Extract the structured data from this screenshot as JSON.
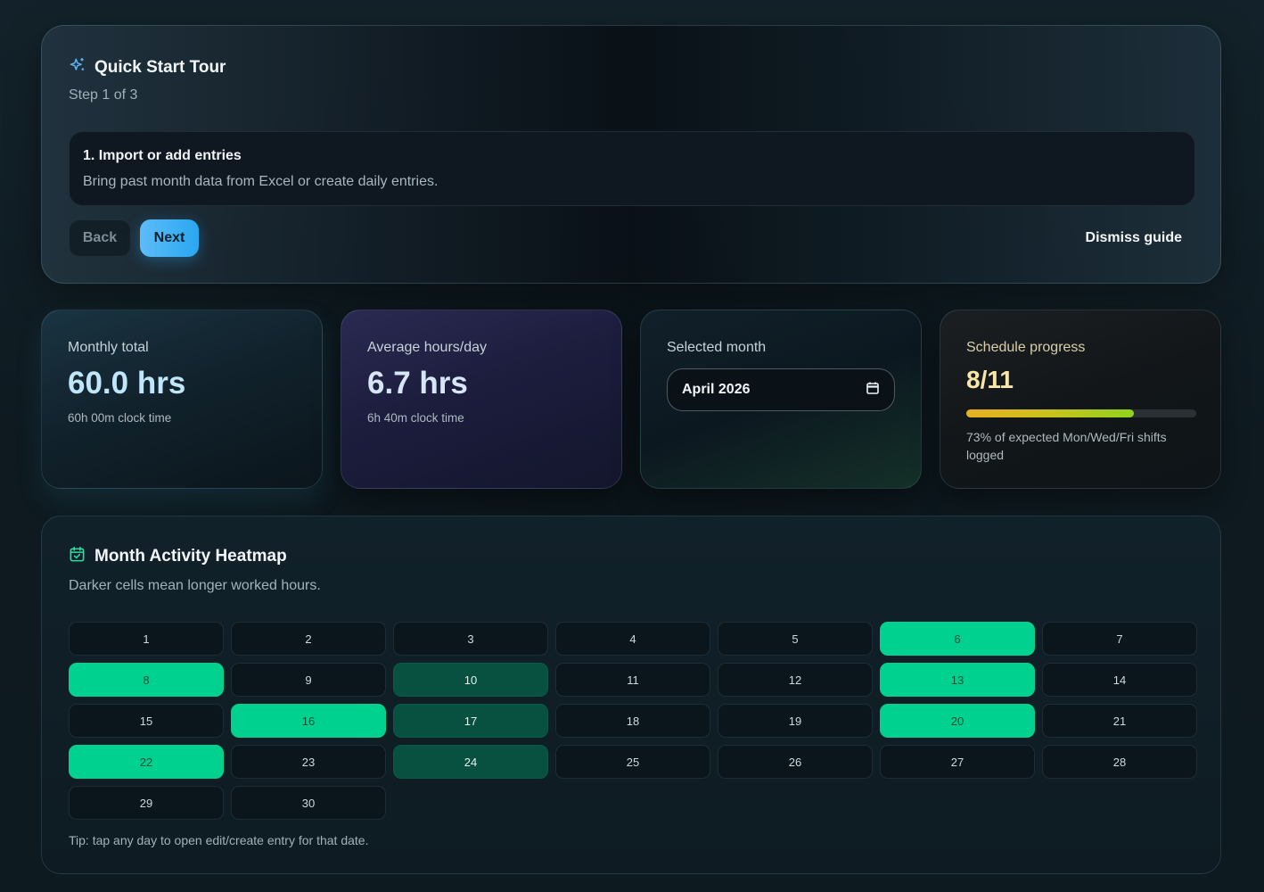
{
  "tour": {
    "title": "Quick Start Tour",
    "step": "Step 1 of 3",
    "step_title": "1. Import or add entries",
    "step_desc": "Bring past month data from Excel or create daily entries.",
    "back_label": "Back",
    "next_label": "Next",
    "dismiss_label": "Dismiss guide",
    "icon": "sparkles-icon"
  },
  "cards": {
    "monthly": {
      "label": "Monthly total",
      "value": "60.0 hrs",
      "sub": "60h 00m clock time"
    },
    "average": {
      "label": "Average hours/day",
      "value": "6.7 hrs",
      "sub": "6h 40m clock time"
    },
    "month": {
      "label": "Selected month",
      "value": "April 2026",
      "icon": "calendar-icon"
    },
    "progress": {
      "label": "Schedule progress",
      "value": "8/11",
      "fraction": 0.73,
      "note": "73% of expected Mon/Wed/Fri shifts logged"
    }
  },
  "heatmap": {
    "title": "Month Activity Heatmap",
    "subtitle": "Darker cells mean longer worked hours.",
    "tip": "Tip: tap any day to open edit/create entry for that date.",
    "icon": "calendar-check-icon",
    "colors": {
      "high": "#00d18e",
      "mid": "#08503f",
      "empty": "#0b151c"
    },
    "days": [
      {
        "d": "1",
        "level": "none"
      },
      {
        "d": "2",
        "level": "none"
      },
      {
        "d": "3",
        "level": "none"
      },
      {
        "d": "4",
        "level": "none"
      },
      {
        "d": "5",
        "level": "none"
      },
      {
        "d": "6",
        "level": "high"
      },
      {
        "d": "7",
        "level": "none"
      },
      {
        "d": "8",
        "level": "high"
      },
      {
        "d": "9",
        "level": "none"
      },
      {
        "d": "10",
        "level": "mid"
      },
      {
        "d": "11",
        "level": "none"
      },
      {
        "d": "12",
        "level": "none"
      },
      {
        "d": "13",
        "level": "high"
      },
      {
        "d": "14",
        "level": "none"
      },
      {
        "d": "15",
        "level": "none"
      },
      {
        "d": "16",
        "level": "high"
      },
      {
        "d": "17",
        "level": "mid"
      },
      {
        "d": "18",
        "level": "none"
      },
      {
        "d": "19",
        "level": "none"
      },
      {
        "d": "20",
        "level": "high"
      },
      {
        "d": "21",
        "level": "none"
      },
      {
        "d": "22",
        "level": "high"
      },
      {
        "d": "23",
        "level": "none"
      },
      {
        "d": "24",
        "level": "mid"
      },
      {
        "d": "25",
        "level": "none"
      },
      {
        "d": "26",
        "level": "none"
      },
      {
        "d": "27",
        "level": "none"
      },
      {
        "d": "28",
        "level": "none"
      },
      {
        "d": "29",
        "level": "none"
      },
      {
        "d": "30",
        "level": "none"
      }
    ]
  }
}
